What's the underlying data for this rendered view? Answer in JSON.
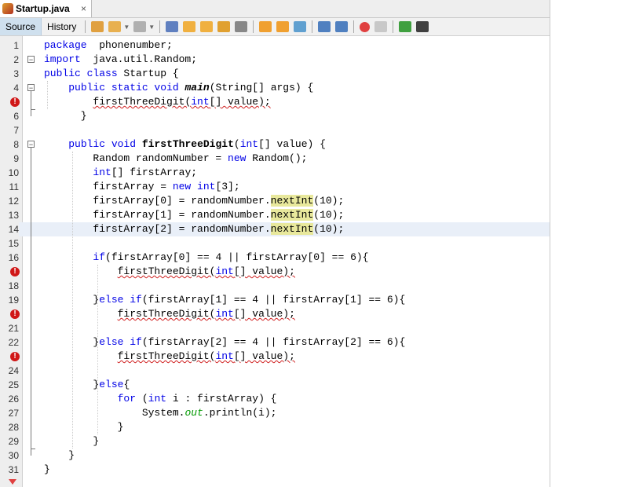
{
  "tab": {
    "title": "Startup.java",
    "close": "×"
  },
  "toolbar": {
    "source_label": "Source",
    "history_label": "History",
    "icons": [
      {
        "name": "last-edit-icon",
        "color": "#e0a040"
      },
      {
        "name": "back-icon",
        "color": "#e8b050",
        "dropdown": true
      },
      {
        "name": "forward-icon",
        "color": "#b0b0b0",
        "dropdown": true
      },
      {
        "sep": true
      },
      {
        "name": "find-icon",
        "color": "#6080c0"
      },
      {
        "name": "find-previous-icon",
        "color": "#f0b040"
      },
      {
        "name": "find-next-icon",
        "color": "#f0b040"
      },
      {
        "name": "toggle-highlight-icon",
        "color": "#e0a030"
      },
      {
        "name": "toggle-rect-selection-icon",
        "color": "#888888"
      },
      {
        "sep": true
      },
      {
        "name": "previous-bookmark-icon",
        "color": "#f0a030"
      },
      {
        "name": "next-bookmark-icon",
        "color": "#f0a030"
      },
      {
        "name": "toggle-bookmark-icon",
        "color": "#60a0d0"
      },
      {
        "sep": true
      },
      {
        "name": "shift-left-icon",
        "color": "#5080c0"
      },
      {
        "name": "shift-right-icon",
        "color": "#5080c0"
      },
      {
        "sep": true
      },
      {
        "name": "start-macro-icon",
        "color": "#e04040",
        "round": true
      },
      {
        "name": "stop-macro-icon",
        "color": "#c8c8c8"
      },
      {
        "sep": true
      },
      {
        "name": "comment-icon",
        "color": "#40a040"
      },
      {
        "name": "uncomment-icon",
        "color": "#404040"
      }
    ]
  },
  "editor": {
    "current_line": 14,
    "colors": {
      "keyword": "#0000e6",
      "error": "#d02020",
      "highlight": "#e8e89c",
      "current_line": "#e9eff8"
    },
    "lines": [
      {
        "n": "1",
        "segments": [
          [
            "kw",
            "package"
          ],
          [
            "",
            "  phonenumber;"
          ]
        ]
      },
      {
        "n": "2",
        "fold": true,
        "segments": [
          [
            "kw",
            "import"
          ],
          [
            "",
            "  java.util.Random;"
          ]
        ]
      },
      {
        "n": "3",
        "segments": [
          [
            "kw",
            "public class"
          ],
          [
            "",
            " Startup {"
          ]
        ]
      },
      {
        "n": "4",
        "fold": true,
        "segments": [
          [
            "",
            "    "
          ],
          [
            "kw",
            "public static void"
          ],
          [
            "",
            " "
          ],
          [
            "bi",
            "main"
          ],
          [
            "",
            "(String[] args) {"
          ]
        ]
      },
      {
        "n": "5",
        "error": true,
        "segments": [
          [
            "",
            "        "
          ],
          [
            "err",
            "firstThreeDigit("
          ],
          [
            "kw err",
            "int"
          ],
          [
            "err",
            "[] value);"
          ]
        ]
      },
      {
        "n": "6",
        "segments": [
          [
            "",
            "      }"
          ]
        ]
      },
      {
        "n": "7",
        "segments": []
      },
      {
        "n": "8",
        "fold": true,
        "segments": [
          [
            "",
            "    "
          ],
          [
            "kw",
            "public void"
          ],
          [
            "",
            " "
          ],
          [
            "b",
            "firstThreeDigit"
          ],
          [
            "",
            "("
          ],
          [
            "kw",
            "int"
          ],
          [
            "",
            "[] value) {"
          ]
        ]
      },
      {
        "n": "9",
        "segments": [
          [
            "",
            "        Random randomNumber = "
          ],
          [
            "kw",
            "new"
          ],
          [
            "",
            " Random();"
          ]
        ]
      },
      {
        "n": "10",
        "segments": [
          [
            "",
            "        "
          ],
          [
            "kw",
            "int"
          ],
          [
            "",
            "[] firstArray;"
          ]
        ]
      },
      {
        "n": "11",
        "segments": [
          [
            "",
            "        firstArray = "
          ],
          [
            "kw",
            "new"
          ],
          [
            "",
            " "
          ],
          [
            "kw",
            "int"
          ],
          [
            "",
            "[3];"
          ]
        ]
      },
      {
        "n": "12",
        "segments": [
          [
            "",
            "        firstArray[0] = randomNumber."
          ],
          [
            "hl",
            "nextInt"
          ],
          [
            "",
            "(10);"
          ]
        ]
      },
      {
        "n": "13",
        "segments": [
          [
            "",
            "        firstArray[1] = randomNumber."
          ],
          [
            "hl",
            "nextInt"
          ],
          [
            "",
            "(10);"
          ]
        ]
      },
      {
        "n": "14",
        "segments": [
          [
            "",
            "        firstArray[2] = randomNumber."
          ],
          [
            "hl",
            "nextInt"
          ],
          [
            "",
            "(10);"
          ]
        ]
      },
      {
        "n": "15",
        "segments": []
      },
      {
        "n": "16",
        "segments": [
          [
            "",
            "        "
          ],
          [
            "kw",
            "if"
          ],
          [
            "",
            "(firstArray[0] == 4 || firstArray[0] == 6){"
          ]
        ]
      },
      {
        "n": "17",
        "error": true,
        "segments": [
          [
            "",
            "            "
          ],
          [
            "err",
            "firstThreeDigit("
          ],
          [
            "kw err",
            "int"
          ],
          [
            "err",
            "[] value);"
          ]
        ]
      },
      {
        "n": "18",
        "segments": []
      },
      {
        "n": "19",
        "segments": [
          [
            "",
            "        }"
          ],
          [
            "kw",
            "else if"
          ],
          [
            "",
            "(firstArray[1] == 4 || firstArray[1] == 6){"
          ]
        ]
      },
      {
        "n": "20",
        "error": true,
        "segments": [
          [
            "",
            "            "
          ],
          [
            "err",
            "firstThreeDigit("
          ],
          [
            "kw err",
            "int"
          ],
          [
            "err",
            "[] value);"
          ]
        ]
      },
      {
        "n": "21",
        "segments": []
      },
      {
        "n": "22",
        "segments": [
          [
            "",
            "        }"
          ],
          [
            "kw",
            "else if"
          ],
          [
            "",
            "(firstArray[2] == 4 || firstArray[2] == 6){"
          ]
        ]
      },
      {
        "n": "23",
        "error": true,
        "segments": [
          [
            "",
            "            "
          ],
          [
            "err",
            "firstThreeDigit("
          ],
          [
            "kw err",
            "int"
          ],
          [
            "err",
            "[] value);"
          ]
        ]
      },
      {
        "n": "24",
        "segments": []
      },
      {
        "n": "25",
        "segments": [
          [
            "",
            "        }"
          ],
          [
            "kw",
            "else"
          ],
          [
            "",
            "{"
          ]
        ]
      },
      {
        "n": "26",
        "segments": [
          [
            "",
            "            "
          ],
          [
            "kw",
            "for"
          ],
          [
            "",
            " ("
          ],
          [
            "kw",
            "int"
          ],
          [
            "",
            " i : firstArray) {"
          ]
        ]
      },
      {
        "n": "27",
        "segments": [
          [
            "",
            "                System."
          ],
          [
            "out",
            "out"
          ],
          [
            "",
            ".println(i);"
          ]
        ]
      },
      {
        "n": "28",
        "segments": [
          [
            "",
            "            }"
          ]
        ]
      },
      {
        "n": "29",
        "segments": [
          [
            "",
            "        }"
          ]
        ]
      },
      {
        "n": "30",
        "segments": [
          [
            "",
            "    }"
          ]
        ]
      },
      {
        "n": "31",
        "segments": [
          [
            "",
            "}"
          ]
        ]
      }
    ]
  }
}
